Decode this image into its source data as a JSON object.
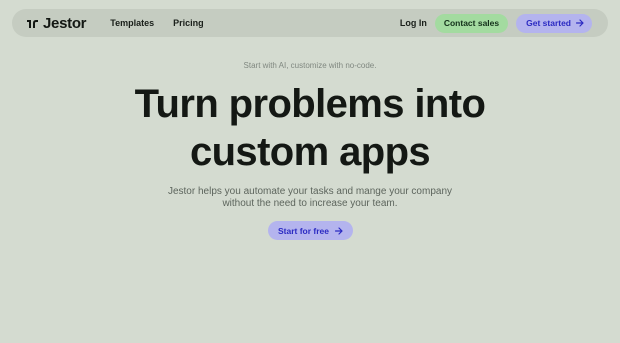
{
  "brand": {
    "name": "Jestor"
  },
  "nav": {
    "links": [
      {
        "label": "Templates"
      },
      {
        "label": "Pricing"
      }
    ],
    "login_label": "Log In",
    "contact_label": "Contact sales",
    "get_started_label": "Get started"
  },
  "hero": {
    "tagline": "Start with AI, customize with no-code.",
    "headline_line1": "Turn problems into",
    "headline_line2": "custom apps",
    "subtitle_line1": "Jestor helps you automate your tasks and mange your company",
    "subtitle_line2": "without the need to increase your team.",
    "cta_label": "Start for free"
  },
  "colors": {
    "background": "#d4dbd0",
    "nav_background": "#c5ccc1",
    "contact_button": "#a3dba0",
    "primary_button": "#b4b4ee",
    "primary_text": "#2b2ac2"
  },
  "icons": {
    "logo": "jestor-logo-icon",
    "arrow": "arrow-right-icon"
  }
}
